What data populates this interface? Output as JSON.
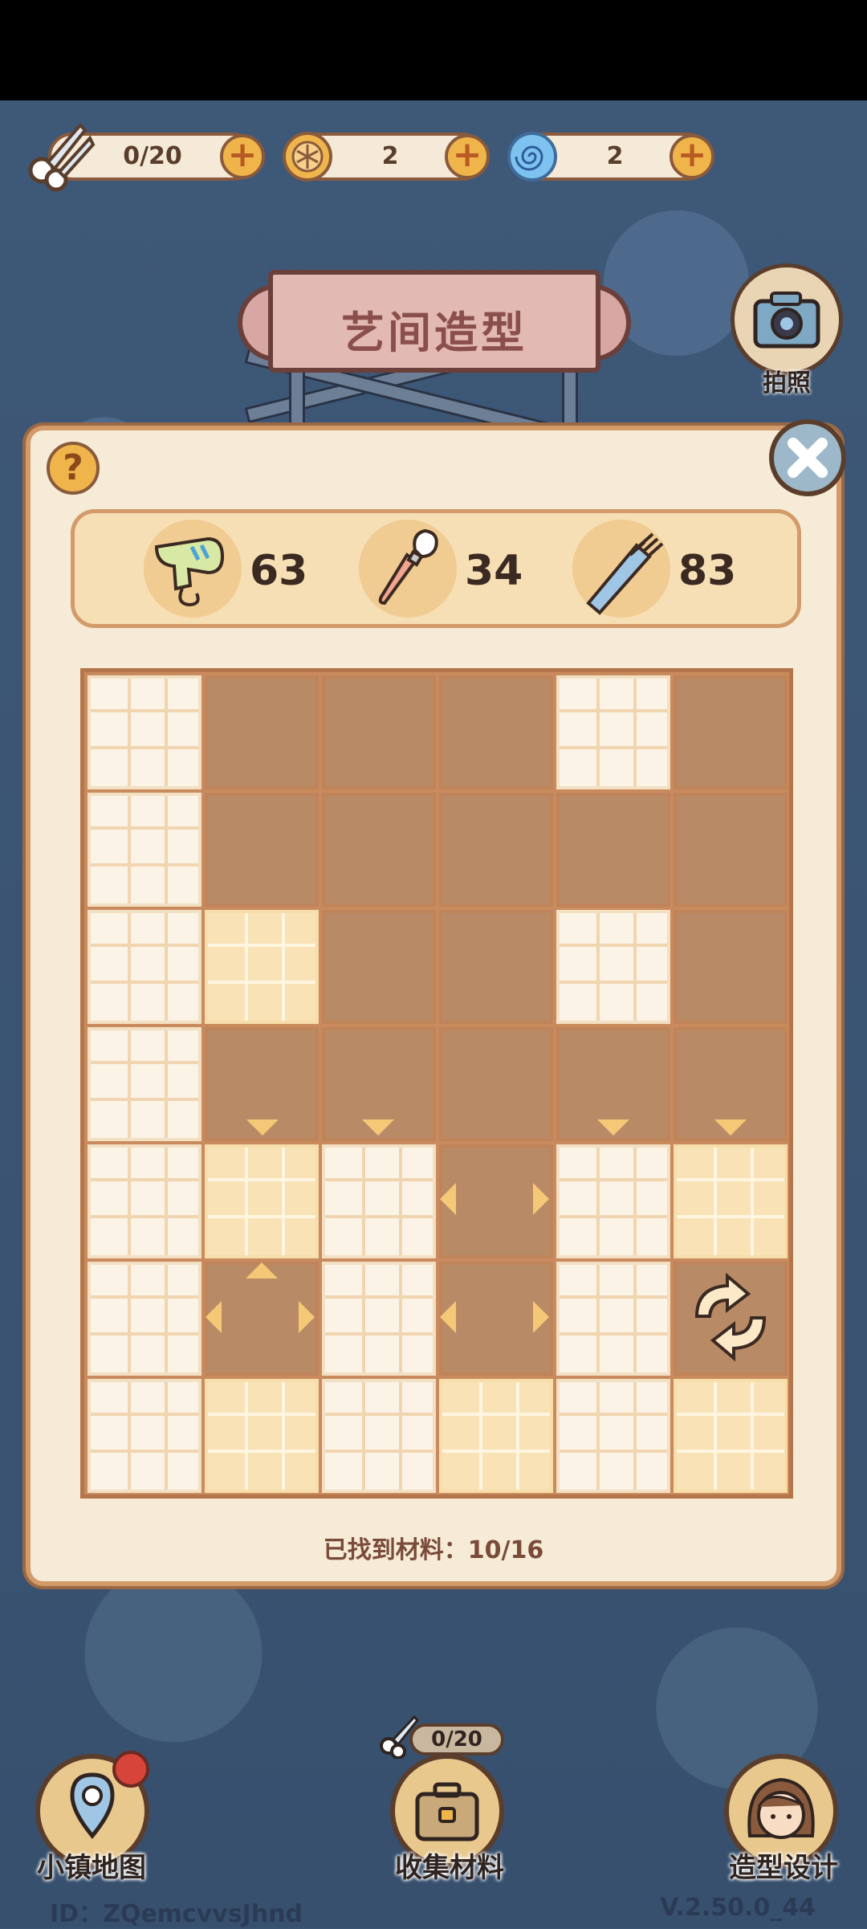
{
  "resources": [
    {
      "name": "scissors",
      "value": "0/20"
    },
    {
      "name": "coin",
      "value": "2"
    },
    {
      "name": "swirl",
      "value": "2"
    }
  ],
  "title": "艺间造型",
  "camera_label": "拍照",
  "tools": [
    {
      "icon": "hair-dryer-icon",
      "count": "63"
    },
    {
      "icon": "makeup-brush-icon",
      "count": "34"
    },
    {
      "icon": "comb-icon",
      "count": "83"
    }
  ],
  "board": {
    "rows": 7,
    "cols": 6,
    "cells": [
      [
        "found",
        "covered",
        "covered",
        "covered",
        "found",
        "covered"
      ],
      [
        "found",
        "covered",
        "covered",
        "covered",
        "covered",
        "covered"
      ],
      [
        "found",
        "found-yellow",
        "covered",
        "covered",
        "found",
        "covered"
      ],
      [
        "found",
        "covered",
        "covered",
        "covered",
        "covered",
        "covered"
      ],
      [
        "found",
        "found-yellow",
        "found",
        "covered",
        "found",
        "found-yellow"
      ],
      [
        "found",
        "covered",
        "found",
        "covered",
        "found",
        "covered"
      ],
      [
        "found",
        "found-yellow",
        "found",
        "found-yellow",
        "found",
        "found-yellow"
      ]
    ]
  },
  "progress_text": "已找到材料：10/16",
  "nav": {
    "map_label": "小镇地图",
    "collect_label": "收集材料",
    "collect_count": "0/20",
    "design_label": "造型设计"
  },
  "footer": {
    "id_text": "ID：ZQemcvvsJhnd",
    "version": "V.2.50.0_44"
  },
  "colors": {
    "panel_bg": "#f6ebd6",
    "covered_tile": "#b98a66",
    "accent_orange": "#f0b54a"
  }
}
